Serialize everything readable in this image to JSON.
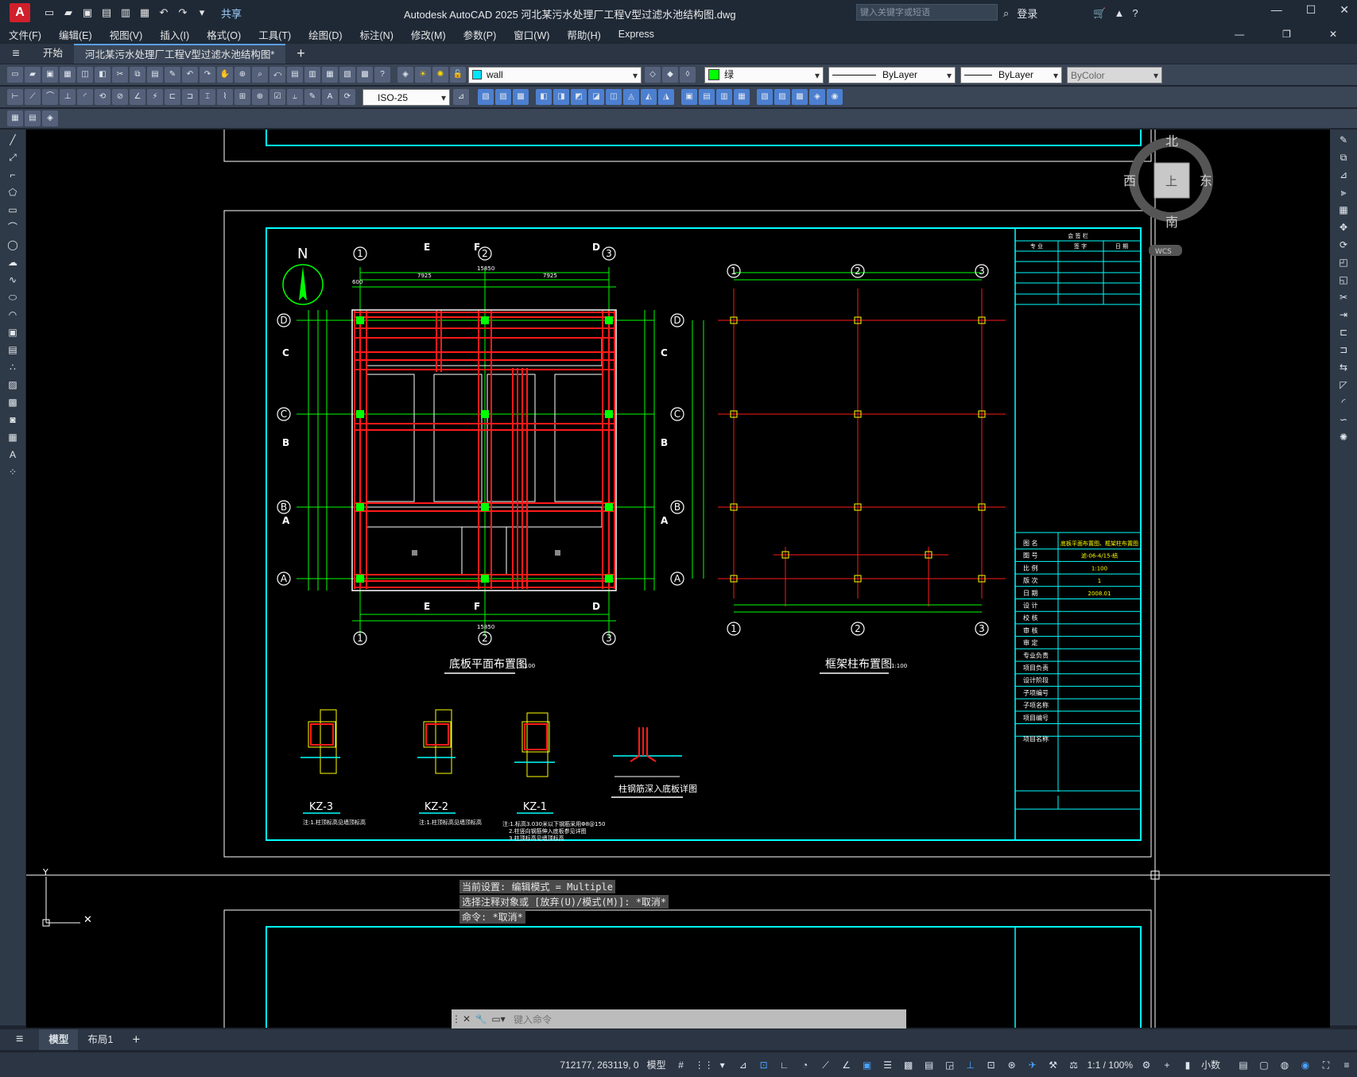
{
  "titlebar": {
    "app_logo": "A",
    "share_label": "共享",
    "title": "Autodesk AutoCAD 2025    河北某污水处理厂工程V型过滤水池结构图.dwg",
    "search_placeholder": "键入关键字或短语",
    "login_label": "登录"
  },
  "menu": {
    "items": [
      "文件(F)",
      "编辑(E)",
      "视图(V)",
      "插入(I)",
      "格式(O)",
      "工具(T)",
      "绘图(D)",
      "标注(N)",
      "修改(M)",
      "参数(P)",
      "窗口(W)",
      "帮助(H)",
      "Express"
    ]
  },
  "tabs": {
    "start": "开始",
    "active": "河北某污水处理厂工程V型过滤水池结构图*",
    "add": "+"
  },
  "toolbar": {
    "layer_name": "wall",
    "color_name": "绿",
    "linetype": "ByLayer",
    "lineweight": "ByLayer",
    "plotstyle": "ByColor",
    "dimstyle": "ISO-25",
    "colors": {
      "layer_swatch": "#00e5ff",
      "color_swatch": "#00ff00"
    }
  },
  "viewcube": {
    "north": "北",
    "south": "南",
    "east": "东",
    "west": "西",
    "top_face": "上",
    "wcs": "WCS"
  },
  "drawing": {
    "plan_title": "底板平面布置图",
    "plan_scale": "1:100",
    "frame_title": "框架柱布置图",
    "frame_scale": "1:100",
    "north_label": "N",
    "axes_h": [
      "1",
      "2",
      "3"
    ],
    "axes_v": [
      "D",
      "C",
      "B",
      "A"
    ],
    "section_marks": [
      "E",
      "F",
      "D"
    ],
    "section_letters": [
      "C",
      "B",
      "A"
    ],
    "column_details": [
      "KZ-3",
      "KZ-2",
      "KZ-1"
    ],
    "detail_title": "柱钢筋深入底板详图",
    "notes": [
      "注:1.柱顶标高见墙顶标高",
      "注:1.柱顶标高见墙顶标高",
      "注:1.标高3.030米以下钢筋采用Φ8@150",
      "2.柱竖向钢筋伸入底板参见详图",
      "3.柱顶标高见墙顶标高"
    ],
    "titleblock_header": [
      "会 签 栏",
      "专 业",
      "签 字",
      "日 期"
    ],
    "titleblock_rows": [
      {
        "label": "图    名",
        "value": "底板平面布置图、框架柱布置图"
      },
      {
        "label": "图    号",
        "value": "滤-06-4/15-结"
      },
      {
        "label": "比    例",
        "value": "1:100"
      },
      {
        "label": "版    次",
        "value": "1"
      },
      {
        "label": "日    期",
        "value": "2008.01"
      },
      {
        "label": "设    计",
        "value": ""
      },
      {
        "label": "校    核",
        "value": ""
      },
      {
        "label": "审    核",
        "value": ""
      },
      {
        "label": "审    定",
        "value": ""
      },
      {
        "label": "专业负责",
        "value": ""
      },
      {
        "label": "项目负责",
        "value": ""
      },
      {
        "label": "设计阶段",
        "value": ""
      },
      {
        "label": "子项编号",
        "value": ""
      },
      {
        "label": "子项名称",
        "value": ""
      },
      {
        "label": "项目编号",
        "value": ""
      },
      {
        "label": "项目名称",
        "value": ""
      }
    ],
    "dims": {
      "total": "15850",
      "spans": [
        "7925",
        "7925"
      ],
      "edge": "600"
    }
  },
  "command": {
    "line1": "当前设置: 编辑模式 = Multiple",
    "line2": "选择注释对象或 [放弃(U)/模式(M)]: *取消*",
    "line3": "命令: *取消*",
    "input_placeholder": "键入命令"
  },
  "layouts": {
    "model": "模型",
    "layout1": "布局1",
    "add": "+"
  },
  "status": {
    "coords": "712177, 263119, 0",
    "model": "模型",
    "scale": "1:1 / 100%",
    "units": "小数"
  }
}
